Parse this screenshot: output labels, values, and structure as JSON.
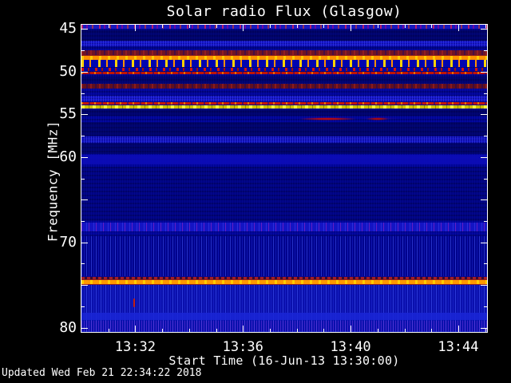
{
  "footer": {
    "updated": "Updated Wed Feb 21 22:34:22 2018"
  },
  "colors": {
    "background": "#000000",
    "plot_base_blue": "#000496",
    "text": "#ffffff",
    "hot_line_orange": "#ff9100",
    "hot_line_yellow": "#ffd200",
    "interference_red": "#d81400",
    "burst_red": "#cc0a00"
  },
  "chart_data": {
    "type": "heatmap",
    "title": "Solar radio Flux (Glasgow)",
    "xlabel": "Start Time (16-Jun-13 13:30:00)",
    "ylabel": "Frequency [MHz]",
    "x_axis": {
      "label": "Start Time (16-Jun-13 13:30:00)",
      "start_time": "13:30:00",
      "span_minutes": 15.07,
      "minor_step_minutes": 1,
      "ticks": [
        {
          "minute": 2,
          "label": "13:32"
        },
        {
          "minute": 6,
          "label": "13:36"
        },
        {
          "minute": 10,
          "label": "13:40"
        },
        {
          "minute": 14,
          "label": "13:44"
        }
      ]
    },
    "y_axis": {
      "label": "Frequency [MHz]",
      "min": 44.5,
      "max": 80.5,
      "minor_step": 2.5,
      "ticks": [
        {
          "value": 45,
          "label": "45"
        },
        {
          "value": 50,
          "label": "50"
        },
        {
          "value": 55,
          "label": "55"
        },
        {
          "value": 60,
          "label": "60"
        },
        {
          "value": 65,
          "label": ""
        },
        {
          "value": 70,
          "label": "70"
        },
        {
          "value": 75,
          "label": ""
        },
        {
          "value": 80,
          "label": "80"
        }
      ]
    },
    "features": [
      {
        "name": "shade-45-46",
        "f1": 45.05,
        "f2": 46.35,
        "kind": "shade"
      },
      {
        "name": "shade-50-51",
        "f1": 50.55,
        "f2": 51.35,
        "kind": "shade"
      },
      {
        "name": "shade-54-55",
        "f1": 54.45,
        "f2": 55.2,
        "kind": "shade"
      },
      {
        "name": "shade-56-57",
        "f1": 55.9,
        "f2": 57.5,
        "kind": "shade"
      },
      {
        "name": "shade-58-59",
        "f1": 58.45,
        "f2": 59.65,
        "kind": "shade"
      },
      {
        "name": "shade-61-67",
        "f1": 61.1,
        "f2": 67.55,
        "kind": "shade-light"
      },
      {
        "name": "grass-69-74",
        "f1": 69.3,
        "f2": 74.0,
        "kind": "grass-dark",
        "base": "#00038d"
      },
      {
        "name": "top-edge-speckle",
        "f1": 44.5,
        "f2": 45.0,
        "kind": "speckle-hot",
        "base": "#1a1abe"
      },
      {
        "name": "band-46-7",
        "f1": 46.4,
        "f2": 47.0,
        "kind": "speckle-blue",
        "base": "#1414c8"
      },
      {
        "name": "maroon-band-47-8",
        "f1": 47.5,
        "f2": 48.05,
        "kind": "maroon",
        "base": "#6e1426"
      },
      {
        "name": "orange-line-48-3",
        "f1": 48.12,
        "f2": 48.58,
        "kind": "line-orange",
        "base": "#ff9100"
      },
      {
        "name": "rfi-yellow-dashes",
        "f1": 48.62,
        "f2": 49.5,
        "kind": "dash-yellow",
        "base": "#0005b0"
      },
      {
        "name": "rfi-red-dashes",
        "f1": 49.52,
        "f2": 49.95,
        "kind": "dash-red",
        "base": "#0004a6"
      },
      {
        "name": "red-line-50-2",
        "f1": 49.98,
        "f2": 50.32,
        "kind": "line-red",
        "base": "#c01400"
      },
      {
        "name": "maroon-band-51-7",
        "f1": 51.4,
        "f2": 51.95,
        "kind": "maroon",
        "base": "#601020"
      },
      {
        "name": "band-53-2",
        "f1": 52.8,
        "f2": 53.5,
        "kind": "speckle-blue",
        "base": "#1414c8"
      },
      {
        "name": "red-line-53-7",
        "f1": 53.56,
        "f2": 53.88,
        "kind": "line-red",
        "base": "#c41600"
      },
      {
        "name": "yellow-line-54-1",
        "f1": 53.92,
        "f2": 54.34,
        "kind": "line-yellow",
        "base": "#cfc000"
      },
      {
        "name": "speckle-band-58",
        "f1": 57.6,
        "f2": 58.35,
        "kind": "speckle-blue",
        "base": "#1111bf"
      },
      {
        "name": "soft-band-60-3",
        "f1": 59.75,
        "f2": 60.9,
        "kind": "soft-blue",
        "base": "#0d0dbb"
      },
      {
        "name": "speckle-band-68",
        "f1": 67.7,
        "f2": 68.75,
        "kind": "speckle-purple",
        "base": "#1414c4"
      },
      {
        "name": "maroon-dash-74-2",
        "f1": 74.03,
        "f2": 74.33,
        "kind": "dash-maroon",
        "base": "#6a1424"
      },
      {
        "name": "orange-line-74-6",
        "f1": 74.38,
        "f2": 74.9,
        "kind": "line-orange",
        "base": "#ff9800"
      },
      {
        "name": "grass-75-80",
        "f1": 74.95,
        "f2": 80.5,
        "kind": "grass",
        "base": "#0a10ad"
      },
      {
        "name": "soft-band-78-7",
        "f1": 78.3,
        "f2": 79.1,
        "kind": "soft-blue",
        "base": "#1a26d6"
      },
      {
        "name": "purple-tint-bottom",
        "f1": 79.2,
        "f2": 80.45,
        "kind": "purple-tint"
      }
    ],
    "events": [
      {
        "name": "burst-smear-tail",
        "f1": 55.35,
        "f2": 55.65,
        "t1": 10.3,
        "t2": 11.9,
        "color": "#4a0a80",
        "shape": "faint"
      },
      {
        "name": "burst-smear-main",
        "f1": 55.3,
        "f2": 55.72,
        "t1": 8.0,
        "t2": 10.3,
        "color": "#cc0a00",
        "shape": "smear"
      },
      {
        "name": "burst-smear-blob",
        "f1": 55.35,
        "f2": 55.68,
        "t1": 10.55,
        "t2": 11.45,
        "color": "#b80a00",
        "shape": "smear"
      },
      {
        "name": "rfi-spike-76-7",
        "f1": 76.6,
        "f2": 77.6,
        "t1": 1.93,
        "t2": 1.99,
        "color": "#d42000",
        "shape": "spike"
      }
    ]
  }
}
